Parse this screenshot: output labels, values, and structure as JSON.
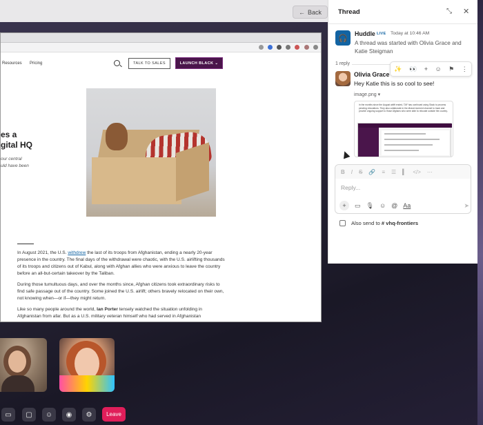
{
  "topbar": {
    "back_label": "Back"
  },
  "screenshare": {
    "nav": {
      "resources": "Resources",
      "pricing": "Pricing",
      "talk_to_sales": "TALK TO SALES",
      "launch_black": "LAUNCH BLACK"
    },
    "hero_title": "es a\ngital HQ",
    "hero_sub": "our central\nuld have been",
    "article": {
      "p1_a": "In August 2021, the U.S. ",
      "p1_link": "withdrew",
      "p1_b": " the last of its troops from Afghanistan, ending a nearly 20-year presence in the country. The final days of the withdrawal were chaotic, with the U.S. airlifting thousands of its troops and citizens out of Kabul, along with Afghan allies who were anxious to leave the country before an all-but-certain takeover by the Taliban.",
      "p2": "During those tumultuous days, and over the months since, Afghan citizens took extraordinary risks to find safe passage out of the country. Some joined the U.S. airlift; others bravely relocated on their own, not knowing when—or if—they might return.",
      "p3_a": "Like so many people around the world, ",
      "p3_bold": "Ian Porter",
      "p3_b": " tensely watched the situation unfolding in Afghanistan from afar. But as a U.S. military veteran himself who had served in Afghanistan"
    }
  },
  "huddle_controls": {
    "leave_label": "Leave"
  },
  "thread": {
    "title": "Thread",
    "parent": {
      "author": "Huddle",
      "badge": "LIVE",
      "time": "Today at 10:46 AM",
      "text": "A thread was started with Olivia Grace and Katie Steigman"
    },
    "reply_count": "1 reply",
    "reply": {
      "author": "Olivia Grace",
      "text": "Hey Katie this is so cool to see!",
      "attachment_name": "image.png",
      "thumb_text": "In the months since the August airlift ended, TAF has continued using Slack to process pending relocations. They also collaborate in the #travel-torment channel to track and provide ongoing support to those Afghans who were able to relocate outside the country."
    },
    "composer": {
      "placeholder": "Reply..."
    },
    "also_send": {
      "label": "Also send to",
      "channel": "# vhq-frontiers"
    }
  }
}
